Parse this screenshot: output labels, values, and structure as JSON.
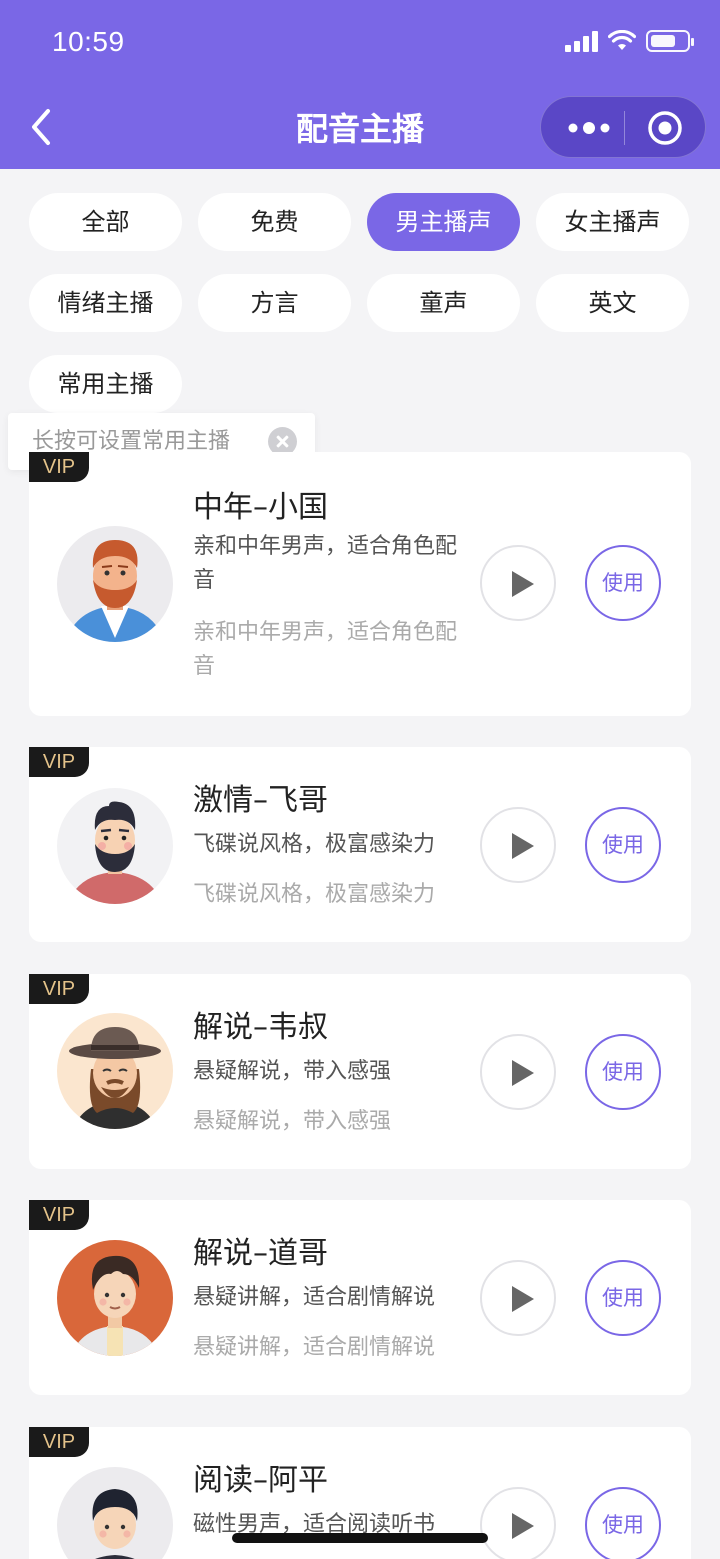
{
  "status_bar": {
    "time": "10:59"
  },
  "header": {
    "title": "配音主播"
  },
  "filters": [
    {
      "label": "全部",
      "active": false
    },
    {
      "label": "免费",
      "active": false
    },
    {
      "label": "男主播声",
      "active": true
    },
    {
      "label": "女主播声",
      "active": false
    },
    {
      "label": "情绪主播",
      "active": false
    },
    {
      "label": "方言",
      "active": false
    },
    {
      "label": "童声",
      "active": false
    },
    {
      "label": "英文",
      "active": false
    },
    {
      "label": "常用主播",
      "active": false
    }
  ],
  "tooltip": {
    "text": "长按可设置常用主播"
  },
  "voices": [
    {
      "badge": "VIP",
      "name": "中年–小国",
      "desc": "亲和中年男声，适合角色配音",
      "sub": "亲和中年男声，适合角色配音",
      "use_label": "使用",
      "avatar": "middle-aged-man-avatar",
      "avatar_bg": "#ecebee"
    },
    {
      "badge": "VIP",
      "name": "激情–飞哥",
      "desc": "飞碟说风格，极富感染力",
      "sub": "飞碟说风格，极富感染力",
      "use_label": "使用",
      "avatar": "bearded-man-avatar",
      "avatar_bg": "#f2f2f4"
    },
    {
      "badge": "VIP",
      "name": "解说–韦叔",
      "desc": "悬疑解说，带入感强",
      "sub": "悬疑解说，带入感强",
      "use_label": "使用",
      "avatar": "hat-man-avatar",
      "avatar_bg": "#fbe6cf"
    },
    {
      "badge": "VIP",
      "name": "解说–道哥",
      "desc": "悬疑讲解，适合剧情解说",
      "sub": "悬疑讲解，适合剧情解说",
      "use_label": "使用",
      "avatar": "young-man-avatar",
      "avatar_bg": "#d9673a"
    },
    {
      "badge": "VIP",
      "name": "阅读–阿平",
      "desc": "磁性男声，适合阅读听书",
      "sub": "",
      "use_label": "使用",
      "avatar": "reader-man-avatar",
      "avatar_bg": "#ecebee"
    }
  ],
  "colors": {
    "accent": "#7a67e6",
    "vip_gold": "#e4c38a",
    "background": "#f4f4f6"
  }
}
